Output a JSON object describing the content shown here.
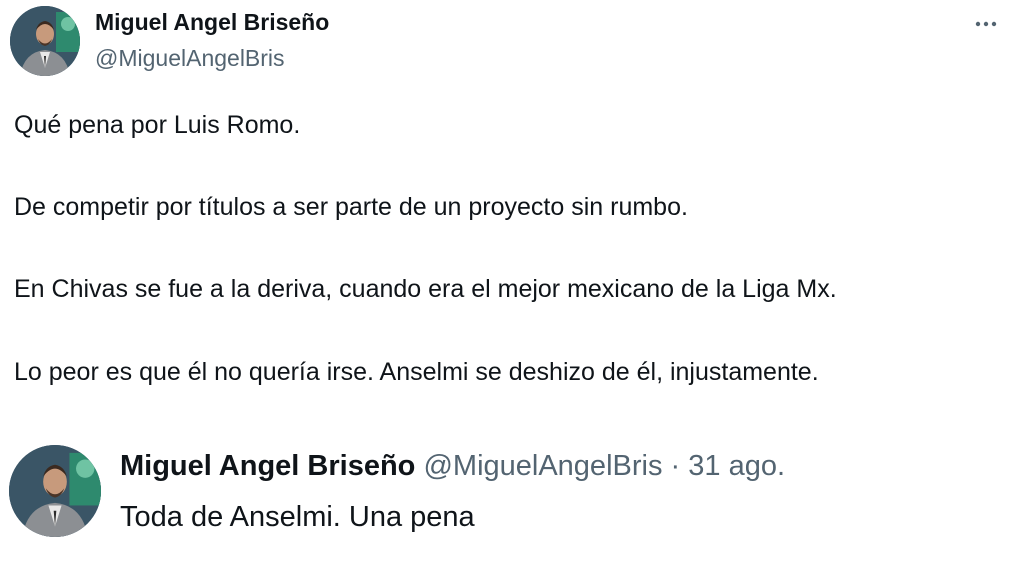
{
  "tweet": {
    "author_name": "Miguel Angel Briseño",
    "author_handle": "@MiguelAngelBris",
    "more_icon": "more-horizontal-icon",
    "lines": [
      "Qué pena por Luis Romo.",
      "De competir por títulos a ser parte de un proyecto sin rumbo.",
      "En Chivas se fue a la deriva, cuando era el mejor mexicano de la Liga Mx.",
      "Lo peor es que él no quería irse. Anselmi se deshizo de él, injustamente."
    ]
  },
  "quoted_tweet": {
    "author_name": "Miguel Angel Briseño",
    "author_handle": "@MiguelAngelBris",
    "separator": "·",
    "date": "31 ago.",
    "text": "Toda de Anselmi. Una pena"
  },
  "colors": {
    "text_primary": "#0f1419",
    "text_secondary": "#536471",
    "background": "#ffffff"
  }
}
